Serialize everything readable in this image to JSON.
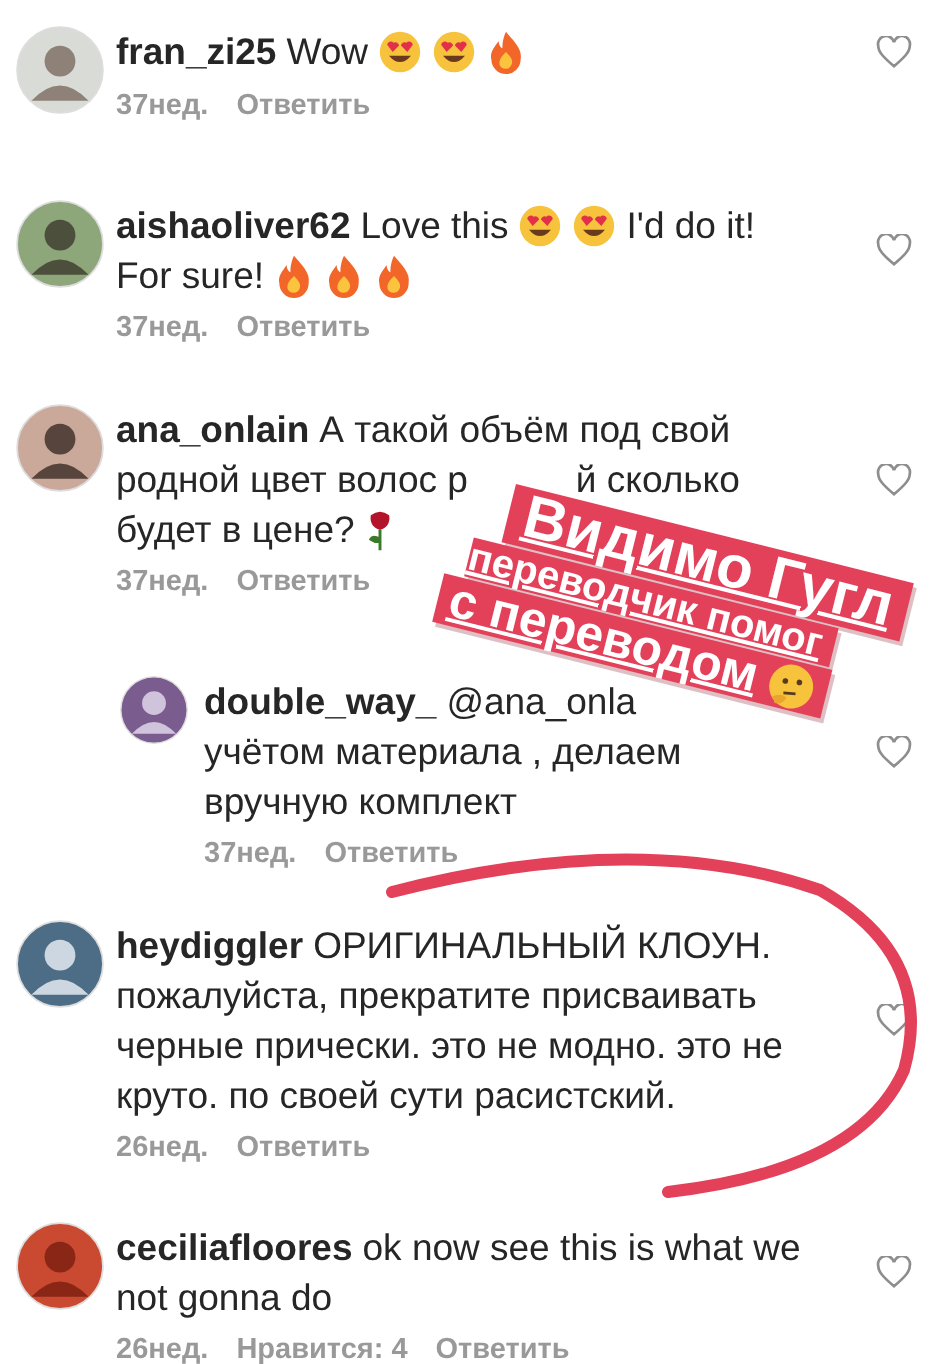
{
  "comments": [
    {
      "lines": [
        [
          {
            "kind": "username",
            "text": "fran_zi25"
          },
          {
            "kind": "text",
            "text": "Wow"
          },
          {
            "kind": "heart_eyes"
          },
          {
            "kind": "heart_eyes"
          },
          {
            "kind": "fire"
          }
        ]
      ],
      "time": "37нед.",
      "reply_label": "Ответить"
    },
    {
      "lines": [
        [
          {
            "kind": "username",
            "text": "aishaoliver62"
          },
          {
            "kind": "text",
            "text": "Love this"
          },
          {
            "kind": "heart_eyes"
          },
          {
            "kind": "heart_eyes"
          },
          {
            "kind": "text",
            "text": "I'd do it!"
          }
        ],
        [
          {
            "kind": "text",
            "text": "For sure!"
          },
          {
            "kind": "fire"
          },
          {
            "kind": "fire"
          },
          {
            "kind": "fire"
          }
        ]
      ],
      "time": "37нед.",
      "reply_label": "Ответить"
    },
    {
      "lines": [
        [
          {
            "kind": "username",
            "text": "ana_onlain"
          },
          {
            "kind": "text",
            "text": "А такой объём под свой"
          }
        ],
        [
          {
            "kind": "text",
            "text": "родной цвет волос р"
          },
          {
            "kind": "hidden"
          },
          {
            "kind": "text",
            "text": "й сколько"
          }
        ],
        [
          {
            "kind": "text",
            "text": "будет в цене?"
          },
          {
            "kind": "rose"
          }
        ]
      ],
      "time": "37нед.",
      "reply_label": "Ответить",
      "children": [
        {
          "lines": [
            [
              {
                "kind": "username",
                "text": "double_way_"
              },
              {
                "kind": "text",
                "text": "@ana_onla"
              }
            ],
            [
              {
                "kind": "text",
                "text": "учётом материала , делаем"
              }
            ],
            [
              {
                "kind": "text",
                "text": "вручную комплект"
              }
            ]
          ],
          "time": "37нед.",
          "reply_label": "Ответить"
        }
      ]
    },
    {
      "lines": [
        [
          {
            "kind": "username",
            "text": "heydiggler"
          },
          {
            "kind": "text",
            "text": "ОРИГИНАЛЬНЫЙ КЛОУН."
          }
        ],
        [
          {
            "kind": "text",
            "text": "пожалуйста, прекратите присваивать"
          }
        ],
        [
          {
            "kind": "text",
            "text": "черные прически. это не модно. это не"
          }
        ],
        [
          {
            "kind": "text",
            "text": "круто. по своей сути расистский."
          }
        ]
      ],
      "time": "26нед.",
      "reply_label": "Ответить"
    },
    {
      "lines": [
        [
          {
            "kind": "username",
            "text": "ceciliafloores"
          },
          {
            "kind": "text",
            "text": "ok now see this is what we"
          }
        ],
        [
          {
            "kind": "text",
            "text": "not gonna do"
          }
        ]
      ],
      "time": "26нед.",
      "likes": "Нравится: 4",
      "reply_label": "Ответить"
    }
  ],
  "sticker": {
    "lines": [
      {
        "kind": "big",
        "text": "Видимо Гугл"
      },
      {
        "kind": "small",
        "text": "переводчик помог"
      },
      {
        "kind": "medium_emoji",
        "text": "с переводом"
      }
    ]
  }
}
